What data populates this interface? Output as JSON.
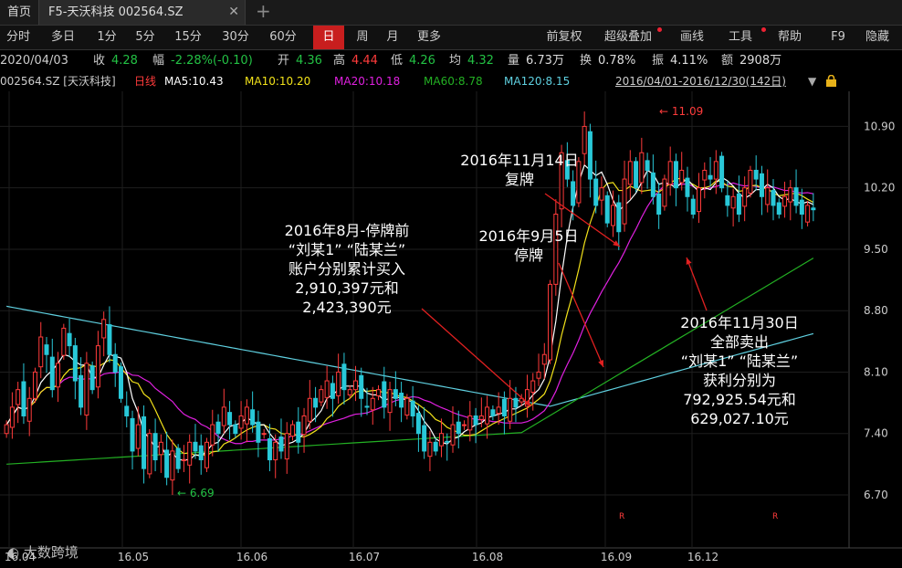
{
  "tabs": {
    "home": "首页",
    "active": "F5-天沃科技 002564.SZ",
    "close": "✕",
    "new": "+"
  },
  "toolbar": {
    "items": [
      "分时",
      "多日",
      "1分",
      "5分",
      "15分",
      "30分",
      "60分",
      "日",
      "周",
      "月",
      "更多"
    ],
    "selected": "日",
    "right_items": [
      "前复权",
      "超级叠加",
      "画线",
      "工具",
      "帮助",
      "F9",
      "隐藏"
    ]
  },
  "info": {
    "date": "2020/04/03",
    "close_label": "收",
    "close_value": "4.28",
    "change_label": "幅",
    "change_value": "-2.28%(-0.10)",
    "open_label": "开",
    "open_value": "4.36",
    "high_label": "高",
    "high_value": "4.44",
    "low_label": "低",
    "low_value": "4.26",
    "avg_label": "均",
    "avg_value": "4.32",
    "vol_label": "量",
    "vol_value": "6.73万",
    "turn_label": "换",
    "turn_value": "0.78%",
    "amp_label": "振",
    "amp_value": "4.11%",
    "amt_label": "额",
    "amt_value": "2908万"
  },
  "ma_row": {
    "stock": "002564.SZ [天沃科技]",
    "period": "日线",
    "ma5": "MA5:10.43",
    "ma10": "MA10:10.20",
    "ma20": "MA20:10.18",
    "ma60": "MA60:8.78",
    "ma120": "MA120:8.15",
    "range": "2016/04/01-2016/12/30(142日)"
  },
  "colors": {
    "up": "#ff3b3b",
    "down": "#29c8d8",
    "ma5": "#ffffff",
    "ma10": "#f2e21a",
    "ma20": "#e020e0",
    "ma60": "#23b023",
    "ma120": "#5fd0e0"
  },
  "chart_data": {
    "type": "candlestick",
    "x_ticks": [
      "16.04",
      "16.05",
      "16.06",
      "16.07",
      "16.08",
      "16.09",
      "16.12"
    ],
    "y_ticks": [
      "10.90",
      "10.20",
      "9.50",
      "8.80",
      "8.10",
      "7.40",
      "6.70"
    ],
    "y_range": [
      6.2,
      11.3
    ],
    "high_marker": "11.09",
    "low_marker": "6.69",
    "r_markers": [
      "R",
      "R"
    ],
    "close_series": [
      7.5,
      7.7,
      7.9,
      7.6,
      7.8,
      8.1,
      8.5,
      8.3,
      7.9,
      8.2,
      8.6,
      8.4,
      8.0,
      7.7,
      8.2,
      7.9,
      8.4,
      8.7,
      8.3,
      8.1,
      7.8,
      7.6,
      7.2,
      7.5,
      7.0,
      7.4,
      7.1,
      7.3,
      6.9,
      7.2,
      7.0,
      7.1,
      7.3,
      7.2,
      7.1,
      7.3,
      7.5,
      7.4,
      7.7,
      7.5,
      7.4,
      7.6,
      7.7,
      7.5,
      7.3,
      7.4,
      7.1,
      7.3,
      7.2,
      7.4,
      7.5,
      7.3,
      7.6,
      7.8,
      7.7,
      7.9,
      8.0,
      7.8,
      8.1,
      7.9,
      7.9,
      8.0,
      7.8,
      7.7,
      7.8,
      7.9,
      7.7,
      7.9,
      7.8,
      7.7,
      7.8,
      7.6,
      7.4,
      7.2,
      7.3,
      7.2,
      7.4,
      7.3,
      7.5,
      7.4,
      7.5,
      7.6,
      7.5,
      7.6,
      7.7,
      7.6,
      7.7,
      7.6,
      7.8,
      7.7,
      7.8,
      7.9,
      8.0,
      8.1,
      8.3,
      9.1,
      9.9,
      10.6,
      10.3,
      10.0,
      10.5,
      10.9,
      10.3,
      10.0,
      10.2,
      9.8,
      10.0,
      9.7,
      10.3,
      10.5,
      10.2,
      10.6,
      10.4,
      10.1,
      9.9,
      10.3,
      10.5,
      10.2,
      10.4,
      10.1,
      9.9,
      10.2,
      10.4,
      10.3,
      10.5,
      10.2,
      10.0,
      10.1,
      9.9,
      10.2,
      10.4,
      10.3,
      10.1,
      10.2,
      10.0,
      9.9,
      10.1,
      10.2,
      10.0,
      9.9,
      10.0,
      9.95
    ]
  },
  "annotations": {
    "a1": [
      "2016年8月-停牌前",
      "“刘某1” “陆某兰”",
      "账户分别累计买入",
      "2,910,397元和",
      "2,423,390元"
    ],
    "a2": [
      "2016年11月14日",
      "复牌"
    ],
    "a3": [
      "2016年9月5日",
      "停牌"
    ],
    "a4": [
      "2016年11月30日",
      "全部卖出",
      "“刘某1” “陆某兰”",
      "获利分别为",
      "792,925.54元和",
      "629,027.10元"
    ]
  },
  "watermark": "大数跨境"
}
